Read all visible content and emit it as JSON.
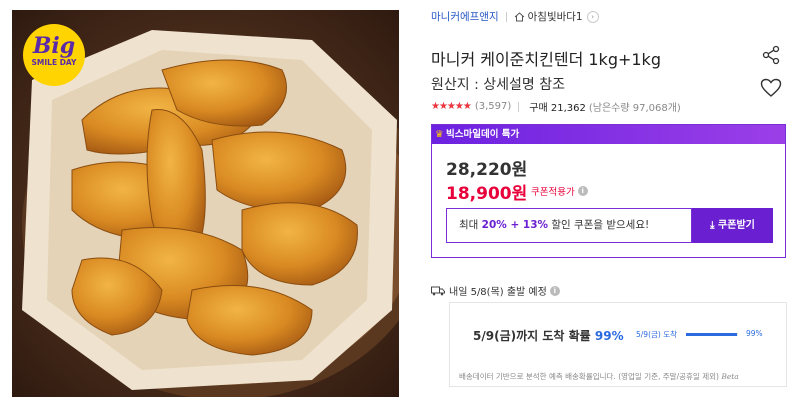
{
  "promo_badge": {
    "big": "Big",
    "sub": "SMILE DAY"
  },
  "product": {
    "seller": "마니커에프앤지",
    "store": "아침빛바다1",
    "store_chevron": "›",
    "title": "마니커 케이준치킨텐더 1kg+1kg",
    "origin": "원산지 : 상세설명 참조",
    "stars": "★★★★★",
    "rating_score": 4.8,
    "review_count": "(3,597)",
    "purchase": "구매 21,362",
    "stock": "(남은수량 97,068개)"
  },
  "deal": {
    "crown": "♛",
    "header": "빅스마일데이 특가",
    "original_price": "28,220원",
    "sale_price": "18,900원",
    "coupon_price_label": "쿠폰적용가",
    "coupon_prefix": "최대 ",
    "coupon_highlight": "20% + 13%",
    "coupon_suffix": " 할인 쿠폰을 받으세요!",
    "coupon_button": "⤓ 쿠폰받기"
  },
  "shipping": {
    "label": "내일 5/8(목) 출발 예정",
    "estimate_prefix": "5/9(금)까지 도착 확률 ",
    "estimate_pct": "99%",
    "mini_label": "5/9(금) 도착",
    "mini_pct": "99%",
    "probability": 0.99,
    "note": "배송데이터 기반으로 분석한 예측 배송확률입니다. (영업일 기준, 주말/공휴일 제외) ",
    "beta": "Beta"
  },
  "colors": {
    "accent": "#6a1fd0",
    "sale": "#e8003a",
    "link": "#2457c5",
    "est": "#2b6be0"
  },
  "icons": {
    "share": "share-icon",
    "heart": "heart-icon",
    "store": "home-icon",
    "truck": "truck-icon",
    "info": "info-icon"
  }
}
